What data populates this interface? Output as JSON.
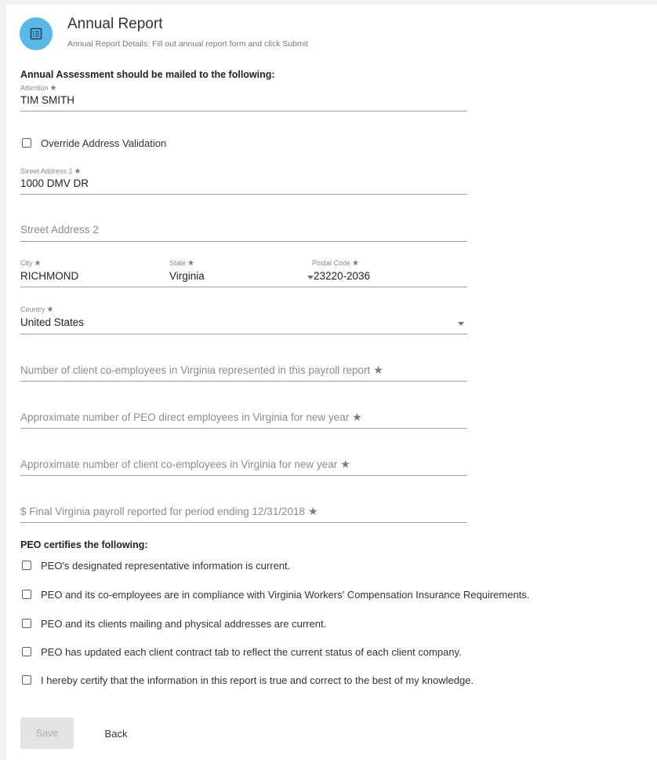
{
  "header": {
    "title": "Annual Report",
    "subtitle": "Annual Report Details: Fill out annual report form and click Submit",
    "icon": "list-document-icon"
  },
  "mailing": {
    "heading": "Annual Assessment should be mailed to the following:",
    "attention": {
      "label": "Attention",
      "value": "TIM SMITH"
    },
    "override": {
      "label": "Override Address Validation",
      "checked": false
    },
    "street1": {
      "label": "Street Address 1",
      "value": "1000 DMV DR"
    },
    "street2": {
      "placeholder": "Street Address 2",
      "value": ""
    },
    "city": {
      "label": "City",
      "value": "RICHMOND"
    },
    "state": {
      "label": "State",
      "value": "Virginia"
    },
    "postal": {
      "label": "Postal Code",
      "value": "23220-2036"
    },
    "country": {
      "label": "Country",
      "value": "United States"
    }
  },
  "fields": {
    "client_coemployees": "Number of client co-employees in Virginia represented in this payroll report",
    "peo_direct": "Approximate number of PEO direct employees in Virginia for new year",
    "client_new_year": "Approximate number of client co-employees in Virginia for new year",
    "final_payroll": "$ Final Virginia payroll reported for period ending 12/31/2018"
  },
  "required_mark": "★",
  "certify": {
    "heading": "PEO certifies the following:",
    "items": [
      {
        "label": "PEO's designated representative information is current.",
        "checked": false
      },
      {
        "label": "PEO and its co-employees are in compliance with Virginia Workers' Compensation Insurance Requirements.",
        "checked": false
      },
      {
        "label": "PEO and its clients mailing and physical addresses are current.",
        "checked": false
      },
      {
        "label": "PEO has updated each client contract tab to reflect the current status of each client company.",
        "checked": false
      },
      {
        "label": "I hereby certify that the information in this report is true and correct to the best of my knowledge.",
        "checked": false
      }
    ]
  },
  "actions": {
    "save_label": "Save",
    "back_label": "Back"
  },
  "colors": {
    "avatar": "#5ab8e8",
    "underline": "#9e9e9e",
    "disabled_button": "#e3e3e3"
  }
}
